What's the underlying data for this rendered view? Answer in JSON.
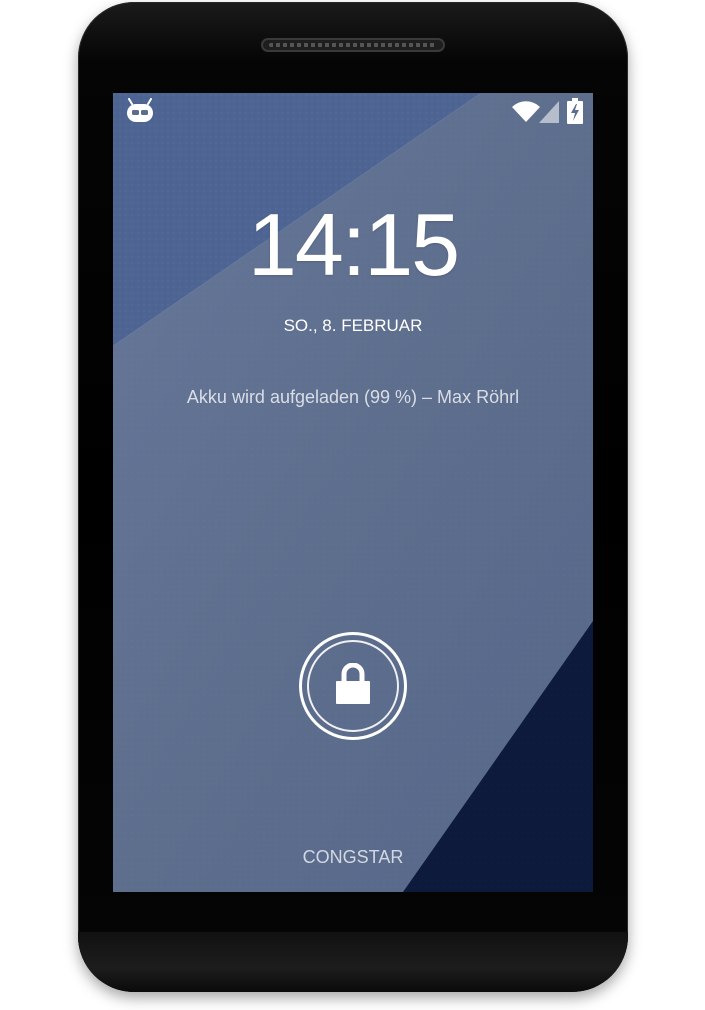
{
  "lockscreen": {
    "time": "14:15",
    "date": "SO., 8. FEBRUAR",
    "charging_info": "Akku wird aufgeladen (99 %) – Max Röhrl",
    "carrier": "CONGSTAR"
  },
  "statusbar": {
    "left_icon": "cyanogenmod-icon",
    "right_icons": [
      "wifi-icon",
      "signal-icon",
      "battery-charging-icon"
    ]
  },
  "colors": {
    "wallpaper_main": "#5d6d8b",
    "wallpaper_top_left": "#4f6692",
    "wallpaper_bottom_right": "#0d1a3a",
    "text": "#ffffff"
  }
}
